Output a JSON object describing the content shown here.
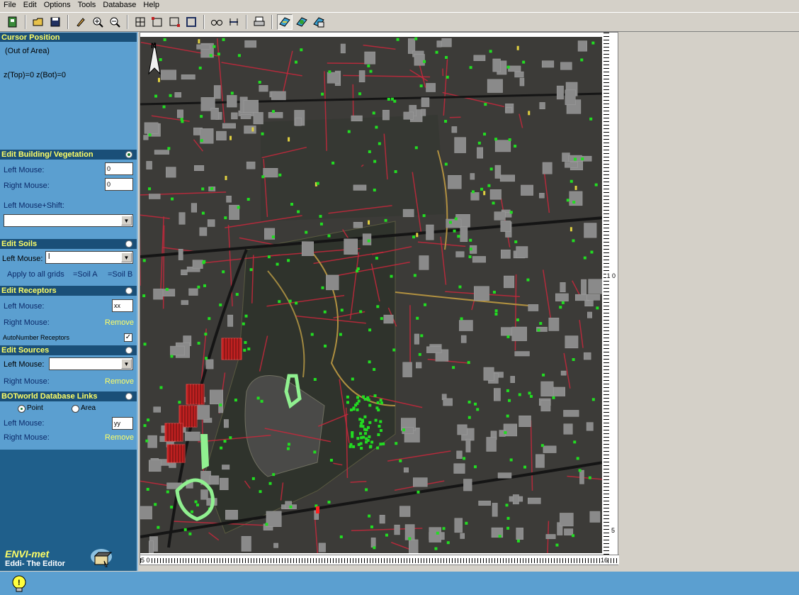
{
  "menu": [
    "File",
    "Edit",
    "Options",
    "Tools",
    "Database",
    "Help"
  ],
  "toolbar": {
    "buttons": [
      "exit-icon",
      "open-folder-icon",
      "save-disk-icon",
      "brush-icon",
      "zoom-in-icon",
      "zoom-out-icon",
      "grid-icon",
      "select-rect-icon",
      "select-rect-alt-icon",
      "frame-icon",
      "binoculars-icon",
      "measure-icon",
      "print-icon",
      "view-buildings-icon",
      "view-vegetation-icon",
      "view-soils-icon"
    ]
  },
  "panel": {
    "cursor": {
      "title": "Cursor Position",
      "status": "(Out of Area)",
      "z_info": "z(Top)=0 z(Bot)=0"
    },
    "building": {
      "title": "Edit Building/ Vegetation",
      "left_label": "Left Mouse:",
      "left_value": "0",
      "right_label": "Right Mouse:",
      "right_value": "0",
      "shift_label": "Left Mouse+Shift:"
    },
    "soils": {
      "title": "Edit Soils",
      "left_label": "Left Mouse:",
      "left_value": "l",
      "apply_label": "Apply to all grids",
      "soil_a": "=Soil A",
      "soil_b": "=Soil B"
    },
    "receptors": {
      "title": "Edit Receptors",
      "left_label": "Left Mouse:",
      "left_value": "xx",
      "right_label": "Right Mouse:",
      "right_value": "Remove",
      "autonumber_label": "AutoNumber Receptors",
      "autonumber_checked": true
    },
    "sources": {
      "title": "Edit Sources",
      "left_label": "Left Mouse:",
      "right_label": "Right Mouse:",
      "right_value": "Remove"
    },
    "botworld": {
      "title": "BOTworld Database Links",
      "point_label": "Point",
      "area_label": "Area",
      "left_label": "Left Mouse:",
      "left_value": "yy",
      "right_label": "Right Mouse:",
      "right_value": "Remove"
    },
    "brand": {
      "name": "ENVI-met",
      "sub": "Eddi- The Editor"
    }
  },
  "map": {
    "north_label": "N",
    "ruler_right_mid": "1 0",
    "ruler_right_low": "5",
    "ruler_bottom_start": "5 0",
    "ruler_bottom_end": "16"
  },
  "colors": {
    "panel_bg": "#1f5f8b",
    "section_body": "#5b9fd0",
    "section_title": "#ffff66",
    "building_outline": "#c8283c",
    "vegetation": "#22dd22"
  }
}
